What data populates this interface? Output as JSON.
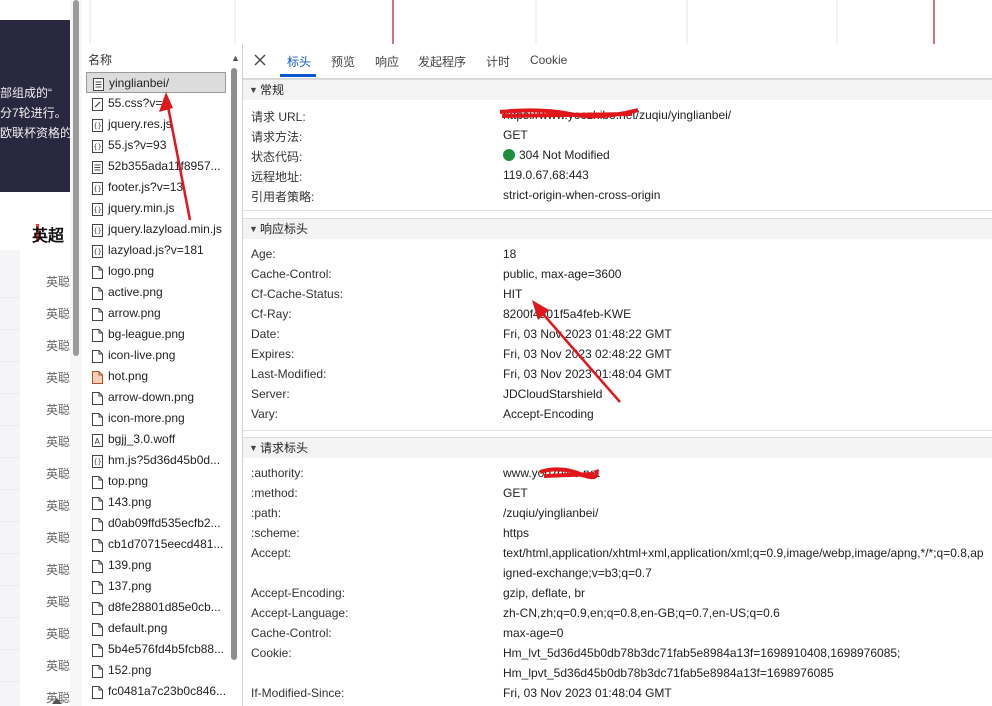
{
  "webpage": {
    "dark_lines": [
      "部组成的“",
      "分7轮进行。",
      "欧联杯资格的"
    ],
    "section_title": "英超",
    "row_label": "英聪",
    "row_count": 14
  },
  "name_list": {
    "header": "名称",
    "files": [
      {
        "name": "yinglianbei/",
        "type": "doc",
        "selected": true
      },
      {
        "name": "55.css?v=5",
        "type": "css"
      },
      {
        "name": "jquery.res.js",
        "type": "js"
      },
      {
        "name": "55.js?v=93",
        "type": "js"
      },
      {
        "name": "52b355ada11f8957...",
        "type": "doc"
      },
      {
        "name": "footer.js?v=13",
        "type": "js"
      },
      {
        "name": "jquery.min.js",
        "type": "js"
      },
      {
        "name": "jquery.lazyload.min.js",
        "type": "js"
      },
      {
        "name": "lazyload.js?v=181",
        "type": "js"
      },
      {
        "name": "logo.png",
        "type": "img"
      },
      {
        "name": "active.png",
        "type": "img"
      },
      {
        "name": "arrow.png",
        "type": "img"
      },
      {
        "name": "bg-league.png",
        "type": "img"
      },
      {
        "name": "icon-live.png",
        "type": "img"
      },
      {
        "name": "hot.png",
        "type": "img-hot"
      },
      {
        "name": "arrow-down.png",
        "type": "img"
      },
      {
        "name": "icon-more.png",
        "type": "img"
      },
      {
        "name": "bgjj_3.0.woff",
        "type": "font"
      },
      {
        "name": "hm.js?5d36d45b0d...",
        "type": "js"
      },
      {
        "name": "top.png",
        "type": "img"
      },
      {
        "name": "143.png",
        "type": "img"
      },
      {
        "name": "d0ab09ffd535ecfb2...",
        "type": "img"
      },
      {
        "name": "cb1d70715eecd481...",
        "type": "img"
      },
      {
        "name": "139.png",
        "type": "img"
      },
      {
        "name": "137.png",
        "type": "img"
      },
      {
        "name": "d8fe28801d85e0cb...",
        "type": "img"
      },
      {
        "name": "default.png",
        "type": "img"
      },
      {
        "name": "5b4e576fd4b5fcb88...",
        "type": "img"
      },
      {
        "name": "152.png",
        "type": "img"
      },
      {
        "name": "fc0481a7c23b0c846...",
        "type": "img"
      }
    ]
  },
  "tabs": [
    "标头",
    "预览",
    "响应",
    "发起程序",
    "计时",
    "Cookie"
  ],
  "active_tab": "标头",
  "general": {
    "title": "常规",
    "rows": [
      {
        "key": "请求 URL:",
        "value": "https://www.yoozhibo.net/zuqiu/yinglianbei/"
      },
      {
        "key": "请求方法:",
        "value": "GET"
      },
      {
        "key": "状态代码:",
        "value": "304 Not Modified"
      },
      {
        "key": "远程地址:",
        "value": "119.0.67.68:443"
      },
      {
        "key": "引用者策略:",
        "value": "strict-origin-when-cross-origin"
      }
    ]
  },
  "response_headers": {
    "title": "响应标头",
    "rows": [
      {
        "key": "Age:",
        "value": "18"
      },
      {
        "key": "Cache-Control:",
        "value": "public, max-age=3600"
      },
      {
        "key": "Cf-Cache-Status:",
        "value": "HIT"
      },
      {
        "key": "Cf-Ray:",
        "value": "8200f4a01f5a4feb-KWE"
      },
      {
        "key": "Date:",
        "value": "Fri, 03 Nov 2023 01:48:22 GMT"
      },
      {
        "key": "Expires:",
        "value": "Fri, 03 Nov 2023 02:48:22 GMT"
      },
      {
        "key": "Last-Modified:",
        "value": "Fri, 03 Nov 2023 01:48:04 GMT"
      },
      {
        "key": "Server:",
        "value": "JDCloudStarshield"
      },
      {
        "key": "Vary:",
        "value": "Accept-Encoding"
      }
    ]
  },
  "request_headers": {
    "title": "请求标头",
    "rows": [
      {
        "key": ":authority:",
        "value": "www.yoozhibo.net"
      },
      {
        "key": ":method:",
        "value": "GET"
      },
      {
        "key": ":path:",
        "value": "/zuqiu/yinglianbei/"
      },
      {
        "key": ":scheme:",
        "value": "https"
      },
      {
        "key": "Accept:",
        "value": "text/html,application/xhtml+xml,application/xml;q=0.9,image/webp,image/apng,*/*;q=0.8,ap"
      },
      {
        "key": "",
        "value": "igned-exchange;v=b3;q=0.7"
      },
      {
        "key": "Accept-Encoding:",
        "value": "gzip, deflate, br"
      },
      {
        "key": "Accept-Language:",
        "value": "zh-CN,zh;q=0.9,en;q=0.8,en-GB;q=0.7,en-US;q=0.6"
      },
      {
        "key": "Cache-Control:",
        "value": "max-age=0"
      },
      {
        "key": "Cookie:",
        "value": "Hm_lvt_5d36d45b0db78b3dc71fab5e8984a13f=1698910408,1698976085;"
      },
      {
        "key": "",
        "value": "Hm_lpvt_5d36d45b0db78b3dc71fab5e8984a13f=1698976085"
      },
      {
        "key": "If-Modified-Since:",
        "value": "Fri, 03 Nov 2023 01:48:04 GMT"
      }
    ]
  },
  "colors": {
    "accent": "#0b57d0",
    "status_ok": "#1e8e3e",
    "annotation": "#e0161b",
    "page_dark": "#2a2840"
  }
}
